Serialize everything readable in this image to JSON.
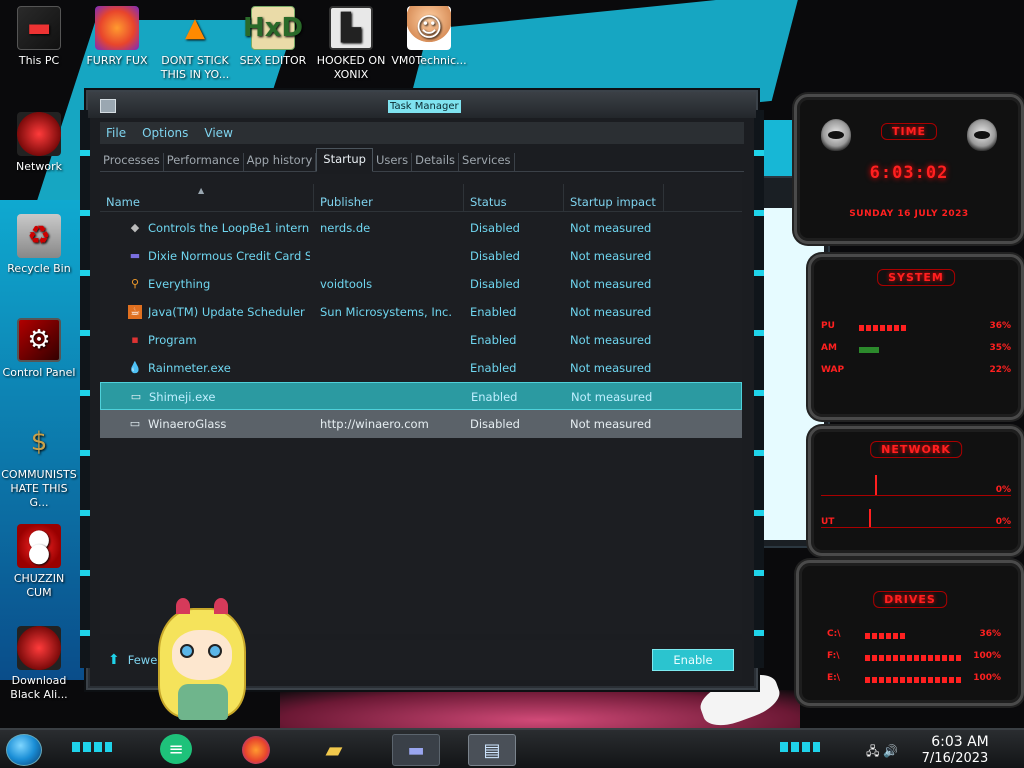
{
  "desktop": {
    "icons": [
      {
        "label": "This PC",
        "icon": "computer-icon"
      },
      {
        "label": "FURRY FUX",
        "icon": "firefox-icon"
      },
      {
        "label": "DONT STICK THIS IN YO...",
        "icon": "vlc-icon"
      },
      {
        "label": "SEX EDITOR",
        "icon": "hxd-icon"
      },
      {
        "label": "HOOKED ON XONIX",
        "icon": "game-icon"
      },
      {
        "label": "VM0Technic...",
        "icon": "doctor-icon"
      },
      {
        "label": "Network",
        "icon": "network-icon"
      },
      {
        "label": "Recycle Bin",
        "icon": "recycle-bin-icon"
      },
      {
        "label": "Control Panel",
        "icon": "control-panel-icon"
      },
      {
        "label": "COMMUNISTS HATE THIS G...",
        "icon": "money-bag-icon"
      },
      {
        "label": "CHUZZIN CUM",
        "icon": "chuzzle-icon"
      },
      {
        "label": "Download Black Ali...",
        "icon": "alien-icon"
      }
    ]
  },
  "task_manager": {
    "title": "Task Manager",
    "menu": [
      "File",
      "Options",
      "View"
    ],
    "tabs": [
      "Processes",
      "Performance",
      "App history",
      "Startup",
      "Users",
      "Details",
      "Services"
    ],
    "active_tab": "Startup",
    "columns": {
      "name": "Name",
      "publisher": "Publisher",
      "status": "Status",
      "impact": "Startup impact"
    },
    "rows": [
      {
        "name": "Controls the LoopBe1 intern...",
        "publisher": "nerds.de",
        "status": "Disabled",
        "impact": "Not measured",
        "icon": "loopbe-icon"
      },
      {
        "name": "Dixie Normous Credit Card S...",
        "publisher": "",
        "status": "Disabled",
        "impact": "Not measured",
        "icon": "credit-card-icon"
      },
      {
        "name": "Everything",
        "publisher": "voidtools",
        "status": "Disabled",
        "impact": "Not measured",
        "icon": "search-icon"
      },
      {
        "name": "Java(TM) Update Scheduler",
        "publisher": "Sun Microsystems, Inc.",
        "status": "Enabled",
        "impact": "Not measured",
        "icon": "java-icon"
      },
      {
        "name": "Program",
        "publisher": "",
        "status": "Enabled",
        "impact": "Not measured",
        "icon": "program-icon"
      },
      {
        "name": "Rainmeter.exe",
        "publisher": "",
        "status": "Enabled",
        "impact": "Not measured",
        "icon": "rainmeter-icon"
      },
      {
        "name": "Shimeji.exe",
        "publisher": "",
        "status": "Enabled",
        "impact": "Not measured",
        "icon": "window-icon"
      },
      {
        "name": "WinaeroGlass",
        "publisher": "http://winaero.com",
        "status": "Disabled",
        "impact": "Not measured",
        "icon": "window-icon"
      }
    ],
    "selected_row": "Shimeji.exe",
    "fewer_details": "Fewer d",
    "enable_button": "Enable"
  },
  "gadgets": {
    "time": {
      "title": "TIME",
      "time": "6:03:02",
      "date": "SUNDAY 16 JULY 2023"
    },
    "system": {
      "title": "SYSTEM",
      "meters": [
        {
          "label": "PU",
          "value": 36,
          "text": "36%"
        },
        {
          "label": "AM",
          "value": 35,
          "text": "35%"
        },
        {
          "label": "WAP",
          "value": 22,
          "text": "22%"
        }
      ]
    },
    "network": {
      "title": "NETWORK",
      "down": "0%",
      "up": "0%",
      "up_label": "UT"
    },
    "drives": {
      "title": "DRIVES",
      "items": [
        {
          "label": "C:\\",
          "value": 36,
          "text": "36%"
        },
        {
          "label": "F:\\",
          "value": 100,
          "text": "100%"
        },
        {
          "label": "E:\\",
          "value": 100,
          "text": "100%"
        }
      ]
    }
  },
  "taskbar": {
    "apps": [
      "chat-app-icon",
      "firefox-icon",
      "file-explorer-icon",
      "credit-card-app-icon",
      "task-manager-icon"
    ],
    "time": "6:03 AM",
    "date": "7/16/2023"
  },
  "colors": {
    "accent": "#1fd3ea",
    "selected_row": "#2b9aa1",
    "gadget_red": "#ff2020"
  }
}
